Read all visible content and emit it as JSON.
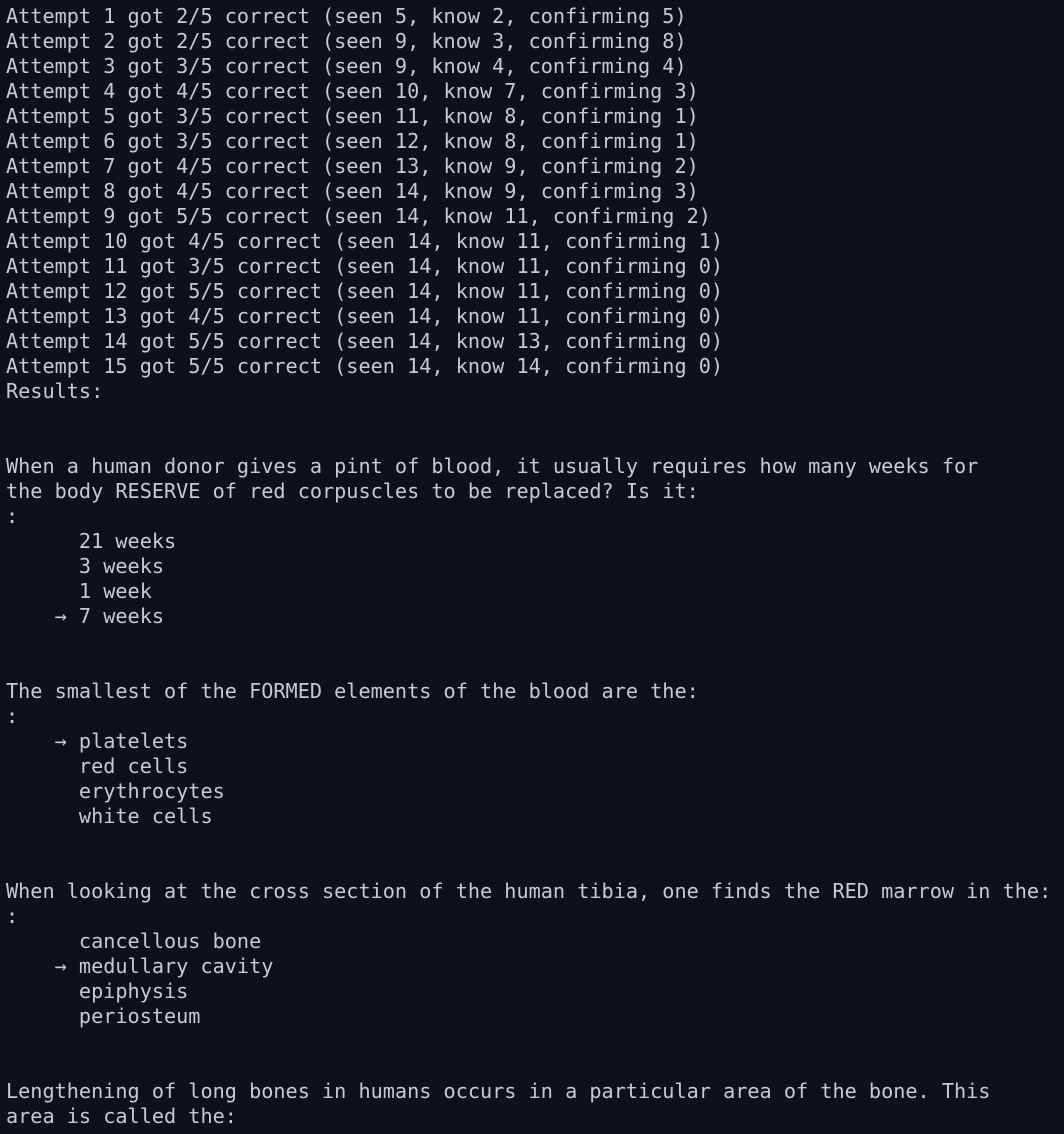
{
  "terminal": {
    "background_color": "#0e1118",
    "text_color": "#c4cad6",
    "attempts": [
      "Attempt 1 got 2/5 correct (seen 5, know 2, confirming 5)",
      "Attempt 2 got 2/5 correct (seen 9, know 3, confirming 8)",
      "Attempt 3 got 3/5 correct (seen 9, know 4, confirming 4)",
      "Attempt 4 got 4/5 correct (seen 10, know 7, confirming 3)",
      "Attempt 5 got 3/5 correct (seen 11, know 8, confirming 1)",
      "Attempt 6 got 3/5 correct (seen 12, know 8, confirming 1)",
      "Attempt 7 got 4/5 correct (seen 13, know 9, confirming 2)",
      "Attempt 8 got 4/5 correct (seen 14, know 9, confirming 3)",
      "Attempt 9 got 5/5 correct (seen 14, know 11, confirming 2)",
      "Attempt 10 got 4/5 correct (seen 14, know 11, confirming 1)",
      "Attempt 11 got 3/5 correct (seen 14, know 11, confirming 0)",
      "Attempt 12 got 5/5 correct (seen 14, know 11, confirming 0)",
      "Attempt 13 got 4/5 correct (seen 14, know 11, confirming 0)",
      "Attempt 14 got 5/5 correct (seen 14, know 13, confirming 0)",
      "Attempt 15 got 5/5 correct (seen 14, know 14, confirming 0)"
    ],
    "results_label": "Results:",
    "colon_line": ":",
    "arrow_marker": "→",
    "questions": [
      {
        "prompt_lines": [
          "When a human donor gives a pint of blood, it usually requires how many weeks for",
          "the body RESERVE of red corpuscles to be replaced? Is it:"
        ],
        "options": [
          {
            "label": "21 weeks",
            "selected": false
          },
          {
            "label": "3 weeks",
            "selected": false
          },
          {
            "label": "1 week",
            "selected": false
          },
          {
            "label": "7 weeks",
            "selected": true
          }
        ]
      },
      {
        "prompt_lines": [
          "The smallest of the FORMED elements of the blood are the:"
        ],
        "options": [
          {
            "label": "platelets",
            "selected": true
          },
          {
            "label": "red cells",
            "selected": false
          },
          {
            "label": "erythrocytes",
            "selected": false
          },
          {
            "label": "white cells",
            "selected": false
          }
        ]
      },
      {
        "prompt_lines": [
          "When looking at the cross section of the human tibia, one finds the RED marrow in the:"
        ],
        "options": [
          {
            "label": "cancellous bone",
            "selected": false
          },
          {
            "label": "medullary cavity",
            "selected": false
          },
          {
            "label": "epiphysis",
            "selected": false
          },
          {
            "label": "periosteum",
            "selected": false
          }
        ],
        "selected_index": 1
      },
      {
        "prompt_lines": [
          "Lengthening of long bones in humans occurs in a particular area of the bone. This",
          "area is called the:"
        ],
        "options": []
      }
    ]
  }
}
